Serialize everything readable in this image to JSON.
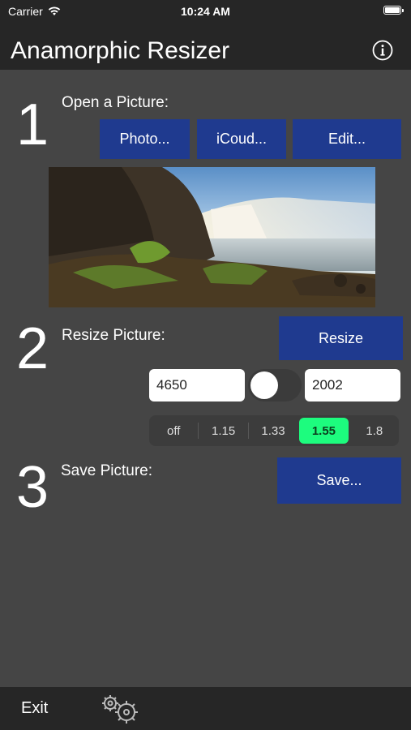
{
  "status_bar": {
    "carrier": "Carrier",
    "time": "10:24 AM"
  },
  "header": {
    "title": "Anamorphic Resizer",
    "info_icon": "info-circle-icon"
  },
  "step1": {
    "number": "1",
    "label": "Open a Picture:",
    "buttons": {
      "photo": "Photo...",
      "icloud": "iCoud...",
      "edit": "Edit..."
    },
    "image": "landscape-waterfall-photo"
  },
  "step2": {
    "number": "2",
    "label": "Resize Picture:",
    "resize_button": "Resize",
    "width_value": "4650",
    "height_value": "2002",
    "segments": [
      "off",
      "1.15",
      "1.33",
      "1.55",
      "1.8"
    ],
    "selected_segment": "1.55"
  },
  "step3": {
    "number": "3",
    "label": "Save Picture:",
    "save_button": "Save..."
  },
  "toolbar": {
    "exit_label": "Exit",
    "settings_icon": "gears-icon"
  },
  "colors": {
    "button": "#1f3a8f",
    "selected_segment": "#1dfc7e",
    "background": "#454545",
    "bar": "#262626"
  }
}
